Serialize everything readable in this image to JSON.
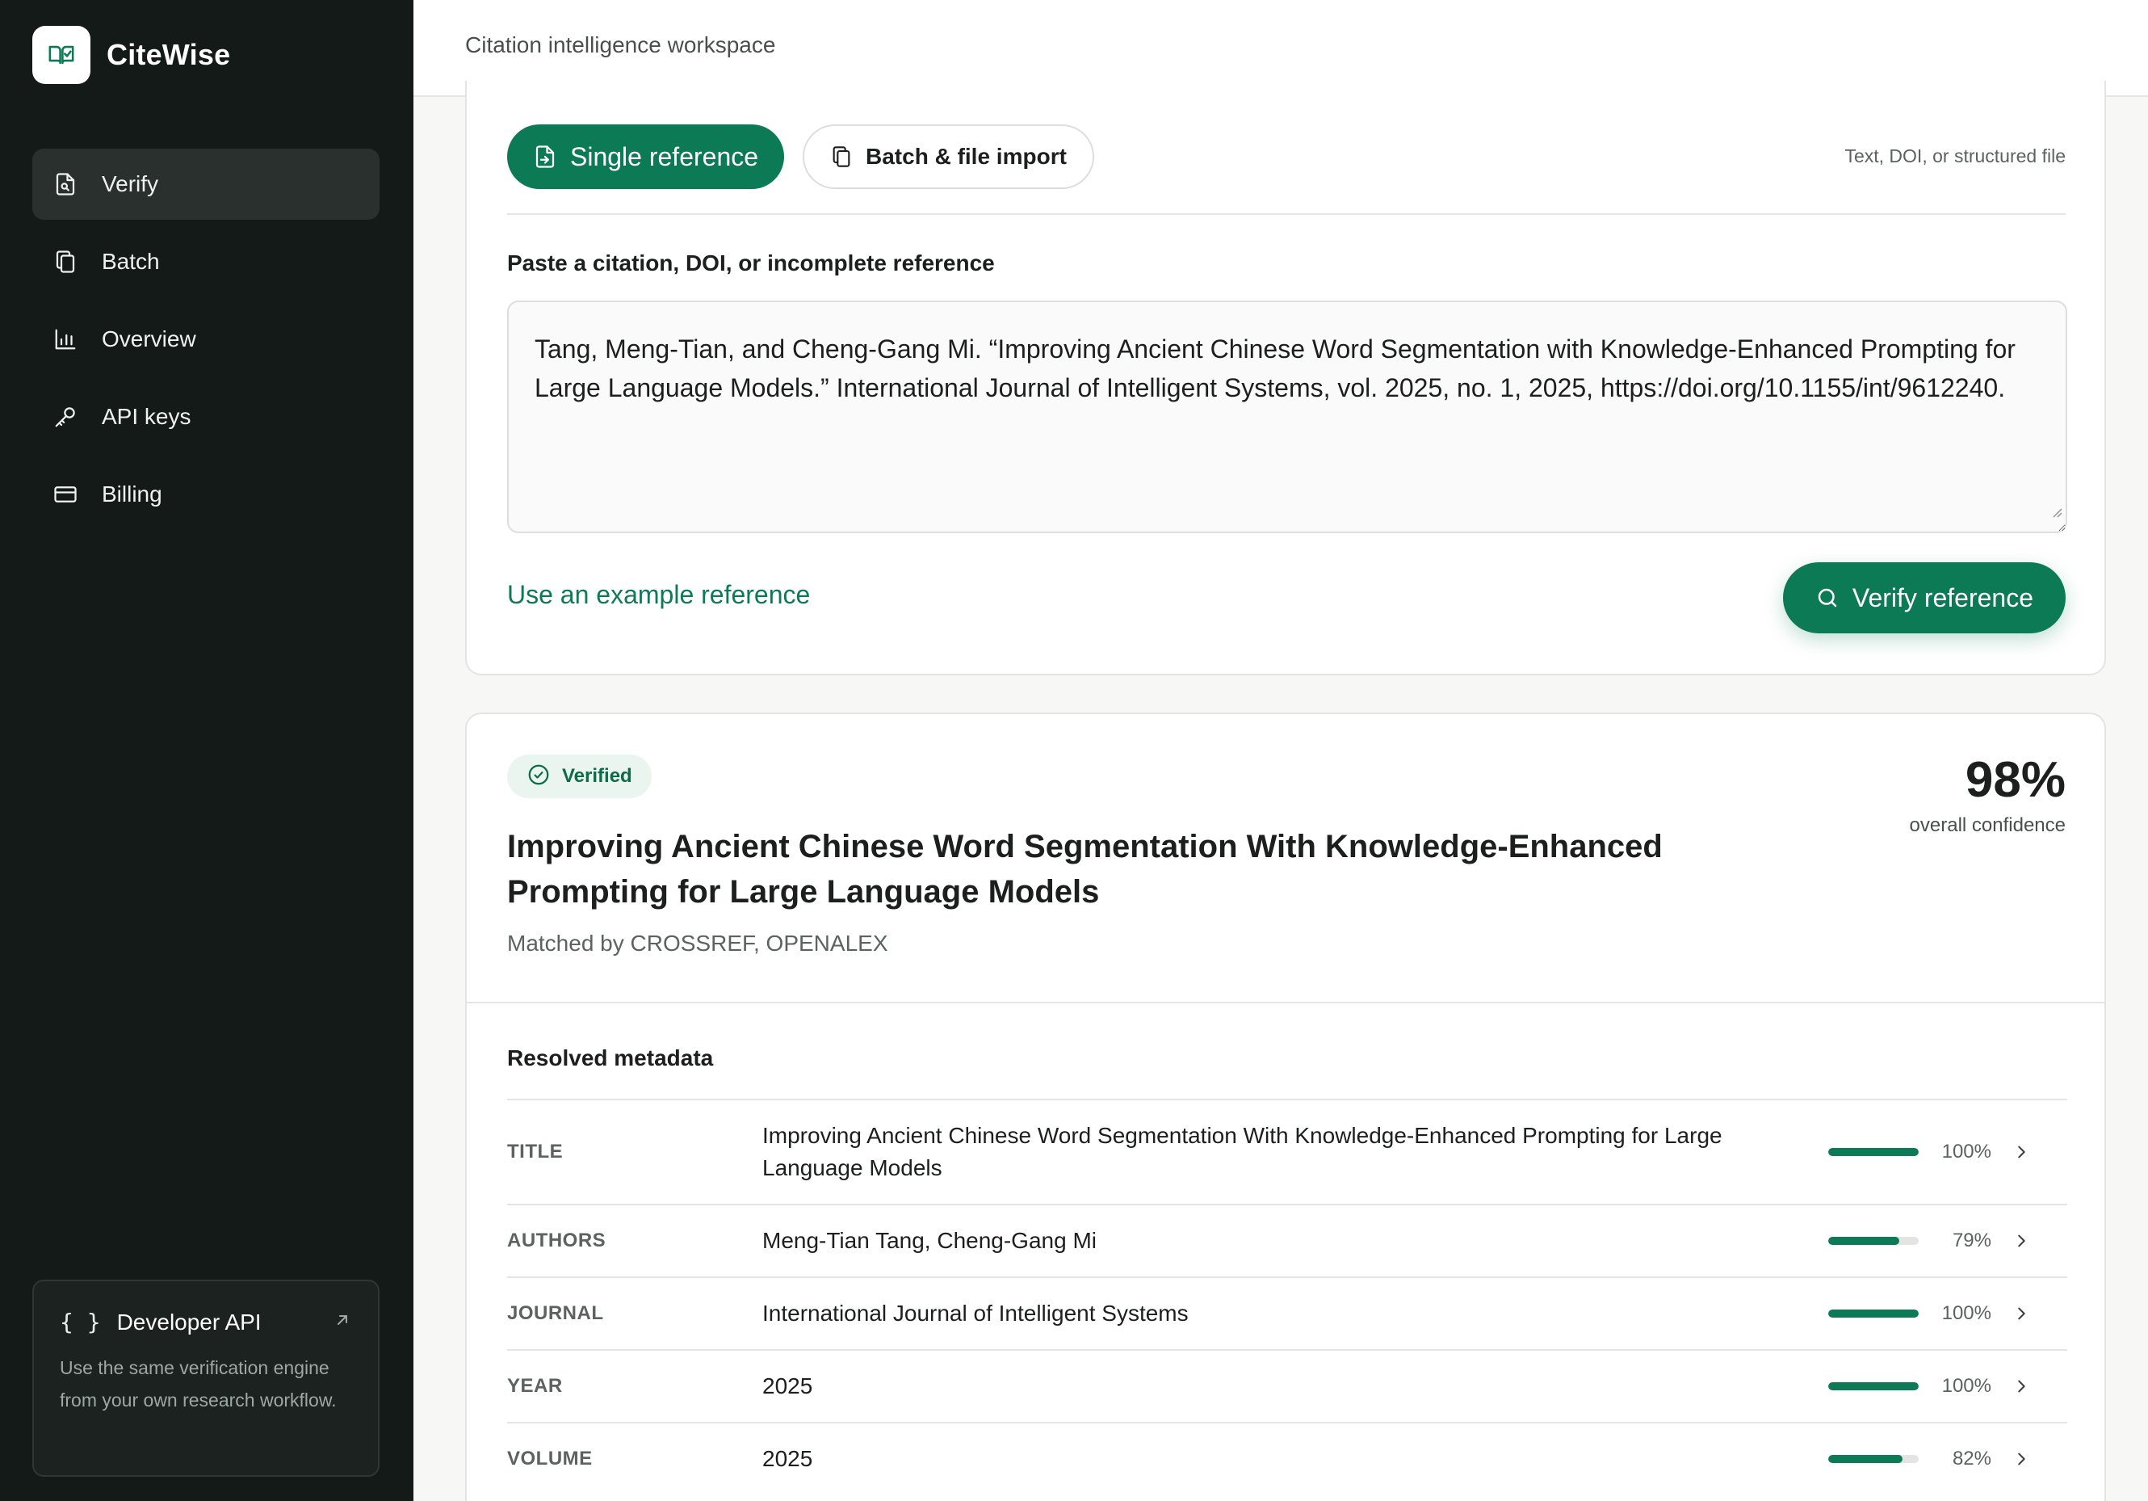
{
  "app": {
    "name": "CiteWise"
  },
  "sidebar": {
    "items": [
      {
        "label": "Verify",
        "icon": "document-check-icon",
        "active": true
      },
      {
        "label": "Batch",
        "icon": "copy-documents-icon",
        "active": false
      },
      {
        "label": "Overview",
        "icon": "bar-chart-icon",
        "active": false
      },
      {
        "label": "API keys",
        "icon": "key-icon",
        "active": false
      },
      {
        "label": "Billing",
        "icon": "credit-card-icon",
        "active": false
      }
    ],
    "developer_card": {
      "icon": "{ }",
      "title": "Developer API",
      "description": "Use the same verification engine from your own research workflow."
    }
  },
  "topbar": {
    "title": "Citation intelligence workspace"
  },
  "input_card": {
    "tabs": [
      {
        "label": "Single reference",
        "selected": true
      },
      {
        "label": "Batch & file import",
        "selected": false
      }
    ],
    "hint": "Text, DOI, or structured file",
    "field_label": "Paste a citation, DOI, or incomplete reference",
    "citation_value": "Tang, Meng-Tian, and Cheng-Gang Mi. “Improving Ancient Chinese Word Segmentation with Knowledge-Enhanced Prompting for Large Language Models.” International Journal of Intelligent Systems, vol. 2025, no. 1, 2025, https://doi.org/10.1155/int/9612240.",
    "example_link": "Use an example reference",
    "verify_button": "Verify reference"
  },
  "result_card": {
    "status": "Verified",
    "confidence": "98%",
    "confidence_label": "overall confidence",
    "title": "Improving Ancient Chinese Word Segmentation With Knowledge-Enhanced Prompting for Large Language Models",
    "matched_by": "Matched by CROSSREF, OPENALEX",
    "metadata_heading": "Resolved metadata",
    "metadata": [
      {
        "key": "TITLE",
        "value": "Improving Ancient Chinese Word Segmentation With Knowledge-Enhanced Prompting for Large Language Models",
        "percent_label": "100%",
        "score": 1.0
      },
      {
        "key": "AUTHORS",
        "value": "Meng-Tian Tang, Cheng-Gang Mi",
        "percent_label": "79%",
        "score": 0.79
      },
      {
        "key": "JOURNAL",
        "value": "International Journal of Intelligent Systems",
        "percent_label": "100%",
        "score": 1.0
      },
      {
        "key": "YEAR",
        "value": "2025",
        "percent_label": "100%",
        "score": 1.0
      },
      {
        "key": "VOLUME",
        "value": "2025",
        "percent_label": "82%",
        "score": 0.82
      }
    ]
  },
  "colors": {
    "brand": "#0d7a56",
    "sidebar_bg": "#141a18",
    "badge_bg": "#eaf5ef"
  }
}
